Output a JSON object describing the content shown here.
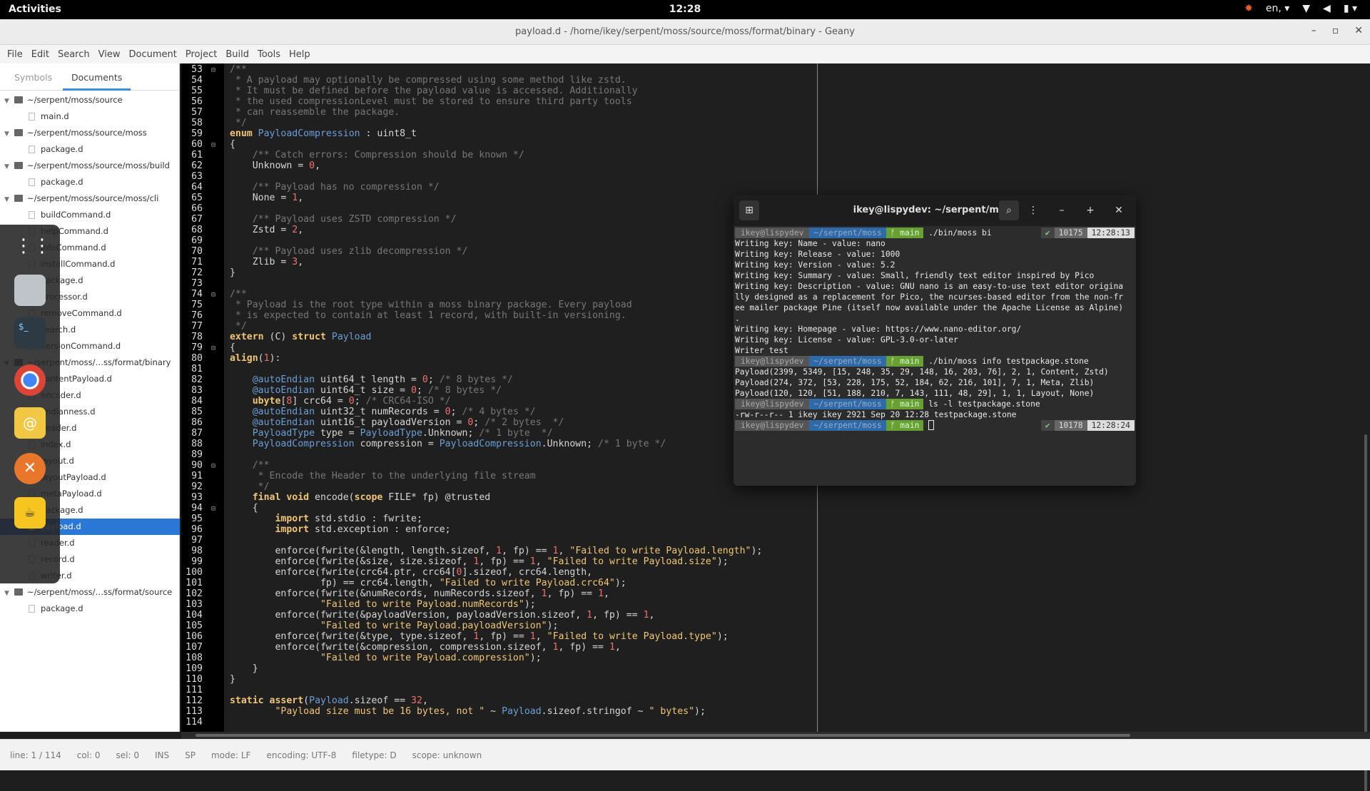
{
  "topbar": {
    "activities": "Activities",
    "clock": "12:28",
    "lang": "en,"
  },
  "window": {
    "title": "payload.d - /home/ikey/serpent/moss/source/moss/format/binary - Geany"
  },
  "menu": [
    "File",
    "Edit",
    "Search",
    "View",
    "Document",
    "Project",
    "Build",
    "Tools",
    "Help"
  ],
  "sidebar": {
    "tabs": [
      "Symbols",
      "Documents"
    ],
    "tree": [
      {
        "kind": "folder",
        "label": "~/serpent/moss/source"
      },
      {
        "kind": "file",
        "label": "main.d"
      },
      {
        "kind": "folder",
        "label": "~/serpent/moss/source/moss"
      },
      {
        "kind": "file",
        "label": "package.d"
      },
      {
        "kind": "folder",
        "label": "~/serpent/moss/source/moss/build"
      },
      {
        "kind": "file",
        "label": "package.d"
      },
      {
        "kind": "folder",
        "label": "~/serpent/moss/source/moss/cli"
      },
      {
        "kind": "file",
        "label": "buildCommand.d"
      },
      {
        "kind": "file",
        "label": "helpCommand.d"
      },
      {
        "kind": "file",
        "label": "infoCommand.d"
      },
      {
        "kind": "file",
        "label": "installCommand.d"
      },
      {
        "kind": "file",
        "label": "package.d"
      },
      {
        "kind": "file",
        "label": "processor.d"
      },
      {
        "kind": "file",
        "label": "removeCommand.d"
      },
      {
        "kind": "file",
        "label": "search.d"
      },
      {
        "kind": "file",
        "label": "versionCommand.d"
      },
      {
        "kind": "folder",
        "label": "~/serpent/moss/…ss/format/binary"
      },
      {
        "kind": "file",
        "label": "contentPayload.d"
      },
      {
        "kind": "file",
        "label": "encoder.d"
      },
      {
        "kind": "file",
        "label": "endianness.d"
      },
      {
        "kind": "file",
        "label": "header.d"
      },
      {
        "kind": "file",
        "label": "index.d"
      },
      {
        "kind": "file",
        "label": "layout.d"
      },
      {
        "kind": "file",
        "label": "layoutPayload.d"
      },
      {
        "kind": "file",
        "label": "metaPayload.d"
      },
      {
        "kind": "file",
        "label": "package.d"
      },
      {
        "kind": "file",
        "label": "payload.d",
        "selected": true
      },
      {
        "kind": "file",
        "label": "reader.d"
      },
      {
        "kind": "file",
        "label": "record.d"
      },
      {
        "kind": "file",
        "label": "writer.d"
      },
      {
        "kind": "folder",
        "label": "~/serpent/moss/…ss/format/source"
      },
      {
        "kind": "file",
        "label": "package.d"
      }
    ]
  },
  "code": [
    {
      "n": "53",
      "f": "⊟",
      "t": [
        [
          "cm",
          "/**"
        ]
      ]
    },
    {
      "n": "54",
      "t": [
        [
          "cm",
          " * A payload may optionally be compressed using some method like zstd."
        ]
      ]
    },
    {
      "n": "55",
      "t": [
        [
          "cm",
          " * It must be defined before the payload value is accessed. Additionally"
        ]
      ]
    },
    {
      "n": "56",
      "t": [
        [
          "cm",
          " * the used compressionLevel must be stored to ensure third party tools"
        ]
      ]
    },
    {
      "n": "57",
      "t": [
        [
          "cm",
          " * can reassemble the package."
        ]
      ]
    },
    {
      "n": "58",
      "t": [
        [
          "cm",
          " */"
        ]
      ]
    },
    {
      "n": "59",
      "t": [
        [
          "kw",
          "enum "
        ],
        [
          "ty",
          "PayloadCompression"
        ],
        [
          "c",
          " : uint8_t"
        ]
      ]
    },
    {
      "n": "60",
      "f": "⊟",
      "t": [
        [
          "c",
          "{"
        ]
      ]
    },
    {
      "n": "61",
      "t": [
        [
          "cm",
          "    /** Catch errors: Compression should be known */"
        ]
      ]
    },
    {
      "n": "62",
      "t": [
        [
          "c",
          "    Unknown = "
        ],
        [
          "num",
          "0"
        ],
        [
          "c",
          ","
        ]
      ]
    },
    {
      "n": "63",
      "t": []
    },
    {
      "n": "64",
      "t": [
        [
          "cm",
          "    /** Payload has no compression */"
        ]
      ]
    },
    {
      "n": "65",
      "t": [
        [
          "c",
          "    None = "
        ],
        [
          "num",
          "1"
        ],
        [
          "c",
          ","
        ]
      ]
    },
    {
      "n": "66",
      "t": []
    },
    {
      "n": "67",
      "t": [
        [
          "cm",
          "    /** Payload uses ZSTD compression */"
        ]
      ]
    },
    {
      "n": "68",
      "t": [
        [
          "c",
          "    Zstd = "
        ],
        [
          "num",
          "2"
        ],
        [
          "c",
          ","
        ]
      ]
    },
    {
      "n": "69",
      "t": []
    },
    {
      "n": "70",
      "t": [
        [
          "cm",
          "    /** Payload uses zlib decompression */"
        ]
      ]
    },
    {
      "n": "71",
      "t": [
        [
          "c",
          "    Zlib = "
        ],
        [
          "num",
          "3"
        ],
        [
          "c",
          ","
        ]
      ]
    },
    {
      "n": "72",
      "t": [
        [
          "c",
          "}"
        ]
      ]
    },
    {
      "n": "73",
      "t": []
    },
    {
      "n": "74",
      "f": "⊟",
      "t": [
        [
          "cm",
          "/**"
        ]
      ]
    },
    {
      "n": "75",
      "t": [
        [
          "cm",
          " * Payload is the root type within a moss binary package. Every payload"
        ]
      ]
    },
    {
      "n": "76",
      "t": [
        [
          "cm",
          " * is expected to contain at least 1 record, with built-in versioning."
        ]
      ]
    },
    {
      "n": "77",
      "t": [
        [
          "cm",
          " */"
        ]
      ]
    },
    {
      "n": "78",
      "t": [
        [
          "kw",
          "extern"
        ],
        [
          "c",
          " (C) "
        ],
        [
          "kw",
          "struct "
        ],
        [
          "ty",
          "Payload"
        ]
      ]
    },
    {
      "n": "79",
      "f": "⊟",
      "t": [
        [
          "c",
          "{"
        ]
      ]
    },
    {
      "n": "80",
      "t": [
        [
          "kw",
          "align"
        ],
        [
          "c",
          "("
        ],
        [
          "num",
          "1"
        ],
        [
          "c",
          "):"
        ]
      ]
    },
    {
      "n": "81",
      "t": []
    },
    {
      "n": "82",
      "t": [
        [
          "at",
          "    @autoEndian"
        ],
        [
          "c",
          " uint64_t length = "
        ],
        [
          "num",
          "0"
        ],
        [
          "c",
          "; "
        ],
        [
          "cm",
          "/* 8 bytes */"
        ]
      ]
    },
    {
      "n": "83",
      "t": [
        [
          "at",
          "    @autoEndian"
        ],
        [
          "c",
          " uint64_t size = "
        ],
        [
          "num",
          "0"
        ],
        [
          "c",
          "; "
        ],
        [
          "cm",
          "/* 8 bytes */"
        ]
      ]
    },
    {
      "n": "84",
      "t": [
        [
          "kw",
          "    ubyte"
        ],
        [
          "c",
          "["
        ],
        [
          "num",
          "8"
        ],
        [
          "c",
          "] crc64 = "
        ],
        [
          "num",
          "0"
        ],
        [
          "c",
          "; "
        ],
        [
          "cm",
          "/* CRC64-ISO */"
        ]
      ]
    },
    {
      "n": "85",
      "t": [
        [
          "at",
          "    @autoEndian"
        ],
        [
          "c",
          " uint32_t numRecords = "
        ],
        [
          "num",
          "0"
        ],
        [
          "c",
          "; "
        ],
        [
          "cm",
          "/* 4 bytes */"
        ]
      ]
    },
    {
      "n": "86",
      "t": [
        [
          "at",
          "    @autoEndian"
        ],
        [
          "c",
          " uint16_t payloadVersion = "
        ],
        [
          "num",
          "0"
        ],
        [
          "c",
          "; "
        ],
        [
          "cm",
          "/* 2 bytes  */"
        ]
      ]
    },
    {
      "n": "87",
      "t": [
        [
          "ty",
          "    PayloadType"
        ],
        [
          "c",
          " type = "
        ],
        [
          "ty",
          "PayloadType"
        ],
        [
          "c",
          ".Unknown; "
        ],
        [
          "cm",
          "/* 1 byte  */"
        ]
      ]
    },
    {
      "n": "88",
      "t": [
        [
          "ty",
          "    PayloadCompression"
        ],
        [
          "c",
          " compression = "
        ],
        [
          "ty",
          "PayloadCompression"
        ],
        [
          "c",
          ".Unknown; "
        ],
        [
          "cm",
          "/* 1 byte */"
        ]
      ]
    },
    {
      "n": "89",
      "t": []
    },
    {
      "n": "90",
      "f": "⊟",
      "t": [
        [
          "cm",
          "    /**"
        ]
      ]
    },
    {
      "n": "91",
      "t": [
        [
          "cm",
          "     * Encode the Header to the underlying file stream"
        ]
      ]
    },
    {
      "n": "92",
      "t": [
        [
          "cm",
          "     */"
        ]
      ]
    },
    {
      "n": "93",
      "t": [
        [
          "kw",
          "    final void"
        ],
        [
          "c",
          " encode("
        ],
        [
          "kw",
          "scope"
        ],
        [
          "c",
          " FILE* fp) @trusted"
        ]
      ]
    },
    {
      "n": "94",
      "f": "⊟",
      "t": [
        [
          "c",
          "    {"
        ]
      ]
    },
    {
      "n": "95",
      "t": [
        [
          "kw",
          "        import"
        ],
        [
          "c",
          " std.stdio : fwrite;"
        ]
      ]
    },
    {
      "n": "96",
      "t": [
        [
          "kw",
          "        import"
        ],
        [
          "c",
          " std.exception : enforce;"
        ]
      ]
    },
    {
      "n": "97",
      "t": []
    },
    {
      "n": "98",
      "t": [
        [
          "c",
          "        enforce(fwrite(&length, length.sizeof, "
        ],
        [
          "num",
          "1"
        ],
        [
          "c",
          ", fp) == "
        ],
        [
          "num",
          "1"
        ],
        [
          "c",
          ", "
        ],
        [
          "str",
          "\"Failed to write Payload.length\""
        ],
        [
          "c",
          ");"
        ]
      ]
    },
    {
      "n": "99",
      "t": [
        [
          "c",
          "        enforce(fwrite(&size, size.sizeof, "
        ],
        [
          "num",
          "1"
        ],
        [
          "c",
          ", fp) == "
        ],
        [
          "num",
          "1"
        ],
        [
          "c",
          ", "
        ],
        [
          "str",
          "\"Failed to write Payload.size\""
        ],
        [
          "c",
          ");"
        ]
      ]
    },
    {
      "n": "100",
      "t": [
        [
          "c",
          "        enforce(fwrite(crc64.ptr, crc64["
        ],
        [
          "num",
          "0"
        ],
        [
          "c",
          "].sizeof, crc64.length,"
        ]
      ]
    },
    {
      "n": "101",
      "t": [
        [
          "c",
          "                fp) == crc64.length, "
        ],
        [
          "str",
          "\"Failed to write Payload.crc64\""
        ],
        [
          "c",
          ");"
        ]
      ]
    },
    {
      "n": "102",
      "t": [
        [
          "c",
          "        enforce(fwrite(&numRecords, numRecords.sizeof, "
        ],
        [
          "num",
          "1"
        ],
        [
          "c",
          ", fp) == "
        ],
        [
          "num",
          "1"
        ],
        [
          "c",
          ","
        ]
      ]
    },
    {
      "n": "103",
      "t": [
        [
          "str",
          "                \"Failed to write Payload.numRecords\""
        ],
        [
          "c",
          ");"
        ]
      ]
    },
    {
      "n": "104",
      "t": [
        [
          "c",
          "        enforce(fwrite(&payloadVersion, payloadVersion.sizeof, "
        ],
        [
          "num",
          "1"
        ],
        [
          "c",
          ", fp) == "
        ],
        [
          "num",
          "1"
        ],
        [
          "c",
          ","
        ]
      ]
    },
    {
      "n": "105",
      "t": [
        [
          "str",
          "                \"Failed to write Payload.payloadVersion\""
        ],
        [
          "c",
          ");"
        ]
      ]
    },
    {
      "n": "106",
      "t": [
        [
          "c",
          "        enforce(fwrite(&type, type.sizeof, "
        ],
        [
          "num",
          "1"
        ],
        [
          "c",
          ", fp) == "
        ],
        [
          "num",
          "1"
        ],
        [
          "c",
          ", "
        ],
        [
          "str",
          "\"Failed to write Payload.type\""
        ],
        [
          "c",
          ");"
        ]
      ]
    },
    {
      "n": "107",
      "t": [
        [
          "c",
          "        enforce(fwrite(&compression, compression.sizeof, "
        ],
        [
          "num",
          "1"
        ],
        [
          "c",
          ", fp) == "
        ],
        [
          "num",
          "1"
        ],
        [
          "c",
          ","
        ]
      ]
    },
    {
      "n": "108",
      "t": [
        [
          "str",
          "                \"Failed to write Payload.compression\""
        ],
        [
          "c",
          ");"
        ]
      ]
    },
    {
      "n": "109",
      "t": [
        [
          "c",
          "    }"
        ]
      ]
    },
    {
      "n": "110",
      "t": [
        [
          "c",
          "}"
        ]
      ]
    },
    {
      "n": "111",
      "t": []
    },
    {
      "n": "112",
      "t": [
        [
          "kw",
          "static assert"
        ],
        [
          "c",
          "("
        ],
        [
          "ty",
          "Payload"
        ],
        [
          "c",
          ".sizeof == "
        ],
        [
          "num",
          "32"
        ],
        [
          "c",
          ","
        ]
      ]
    },
    {
      "n": "113",
      "t": [
        [
          "str",
          "        \"Payload size must be 16 bytes, not \""
        ],
        [
          "c",
          " ~ "
        ],
        [
          "ty",
          "Payload"
        ],
        [
          "c",
          ".sizeof.stringof ~ "
        ],
        [
          "str",
          "\" bytes\""
        ],
        [
          "c",
          ");"
        ]
      ]
    },
    {
      "n": "114",
      "t": []
    }
  ],
  "status": {
    "line": "line: 1 / 114",
    "col": "col: 0",
    "sel": "sel: 0",
    "ins": "INS",
    "sp": "SP",
    "mode": "mode: LF",
    "encoding": "encoding: UTF-8",
    "filetype": "filetype: D",
    "scope": "scope: unknown"
  },
  "terminal": {
    "title": "ikey@lispydev: ~/serpent/moss",
    "prompt": {
      "user": "ikey@lispydev",
      "path": "~/serpent/moss",
      "branch": "ᚠ main"
    },
    "lines": [
      {
        "kind": "prompt",
        "cmd": "./bin/moss bi",
        "ok": "✔",
        "num": "10175",
        "time": "12:28:13"
      },
      {
        "kind": "out",
        "text": "Writing key: Name - value: nano"
      },
      {
        "kind": "out",
        "text": "Writing key: Release - value: 1000"
      },
      {
        "kind": "out",
        "text": "Writing key: Version - value: 5.2"
      },
      {
        "kind": "out",
        "text": "Writing key: Summary - value: Small, friendly text editor inspired by Pico"
      },
      {
        "kind": "out",
        "text": "Writing key: Description - value: GNU nano is an easy-to-use text editor origina"
      },
      {
        "kind": "out",
        "text": "lly designed as a replacement for Pico, the ncurses-based editor from the non-fr"
      },
      {
        "kind": "out",
        "text": "ee mailer package Pine (itself now available under the Apache License as Alpine)"
      },
      {
        "kind": "out",
        "text": "."
      },
      {
        "kind": "out",
        "text": "Writing key: Homepage - value: https://www.nano-editor.org/"
      },
      {
        "kind": "out",
        "text": "Writing key: License - value: GPL-3.0-or-later"
      },
      {
        "kind": "out",
        "text": "Writer test"
      },
      {
        "kind": "prompt",
        "cmd": "./bin/moss info testpackage.stone"
      },
      {
        "kind": "out",
        "text": "Payload(2399, 5349, [15, 248, 35, 29, 148, 16, 203, 76], 2, 1, Content, Zstd)"
      },
      {
        "kind": "out",
        "text": "Payload(274, 372, [53, 228, 175, 52, 184, 62, 216, 101], 7, 1, Meta, Zlib)"
      },
      {
        "kind": "out",
        "text": "Payload(120, 120, [51, 188, 210, 7, 143, 111, 48, 29], 1, 1, Layout, None)"
      },
      {
        "kind": "prompt",
        "cmd": "ls -l testpackage.stone"
      },
      {
        "kind": "out",
        "text": "-rw-r--r-- 1 ikey ikey 2921 Sep 20 12:28 testpackage.stone"
      },
      {
        "kind": "prompt",
        "cmd": "",
        "cursor": true,
        "ok": "✔",
        "num": "10178",
        "time": "12:28:24"
      }
    ]
  }
}
